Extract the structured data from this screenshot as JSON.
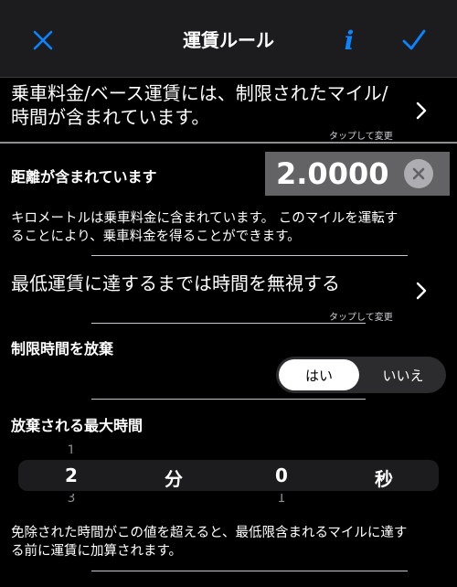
{
  "navbar": {
    "title": "運賃ルール",
    "close_icon": "close-icon",
    "info_label": "i",
    "done_icon": "checkmark-icon"
  },
  "base_fare_rule": {
    "line1": "乗車料金/ベース運賃には、制限されたマイル/",
    "line2": "時間が含まれています。",
    "hint": "タップして変更"
  },
  "distance": {
    "label": "距離が含まれています",
    "value": "2.0000",
    "description_line1": "キロメートルは乗車料金に含まれています。 このマイルを運転す",
    "description_line2": "ることにより、乗車料金を得ることができます。"
  },
  "minimum_fare_rule": {
    "text": "最低運賃に達するまでは時間を無視する",
    "hint": "タップして変更"
  },
  "waive_time": {
    "label": "制限時間を放棄",
    "options": [
      "はい",
      "いいえ"
    ],
    "selected": "はい"
  },
  "max_waived_time": {
    "label": "放棄される最大時間",
    "minutes": "2",
    "minutes_prev": "1",
    "minutes_next": "3",
    "minutes_unit": "分",
    "seconds": "0",
    "seconds_next": "1",
    "seconds_unit": "秒",
    "description_line1": "免除された時間がこの値を超えると、最低限含まれるマイルに達す",
    "description_line2": "る前に運賃に加算されます。"
  },
  "colors": {
    "accent": "#0a84ff",
    "background": "#000000",
    "navbar": "#1c1c1e",
    "field": "#636366"
  }
}
